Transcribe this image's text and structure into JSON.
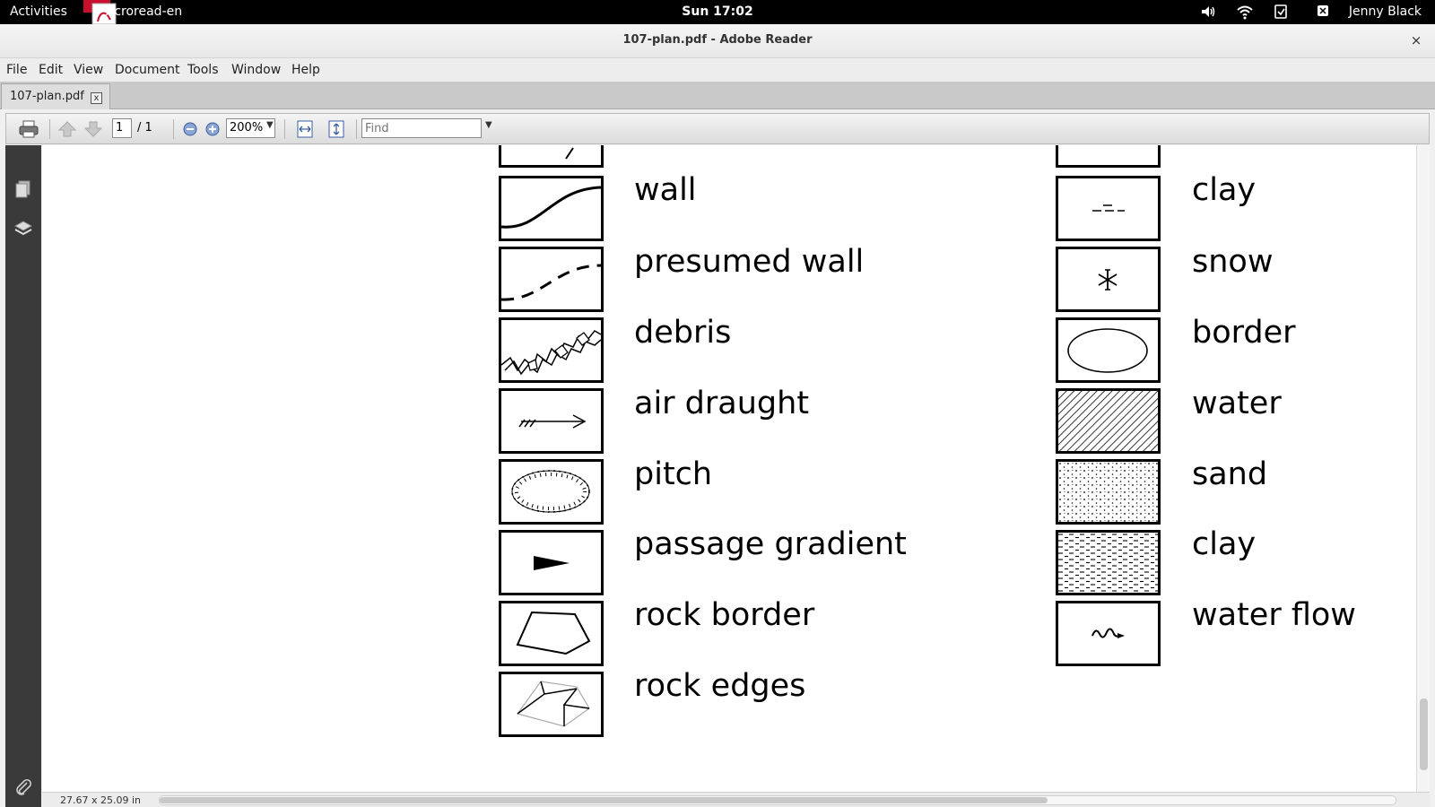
{
  "topbar": {
    "activities": "Activities",
    "app_name": "Acroread-en",
    "clock": "Sun 17:02",
    "user": "Jenny Black"
  },
  "window": {
    "title": "107-plan.pdf - Adobe Reader",
    "close": "×"
  },
  "menu": [
    "File",
    "Edit",
    "View",
    "Document",
    "Tools",
    "Window",
    "Help"
  ],
  "tab": {
    "label": "107-plan.pdf",
    "close": "x"
  },
  "toolbar": {
    "page_current": "1",
    "page_total": "/ 1",
    "zoom": "200%",
    "find_placeholder": "Find"
  },
  "status": {
    "doc_size": "27.67 x 25.09 in"
  },
  "legend": {
    "left": [
      {
        "label": "wall",
        "symbol": "wall-curve-icon"
      },
      {
        "label": "presumed wall",
        "symbol": "dashed-wall-icon"
      },
      {
        "label": "debris",
        "symbol": "debris-icon"
      },
      {
        "label": "air draught",
        "symbol": "air-draught-arrow-icon"
      },
      {
        "label": "pitch",
        "symbol": "pitch-ellipse-icon"
      },
      {
        "label": "passage gradient",
        "symbol": "gradient-triangle-icon"
      },
      {
        "label": "rock border",
        "symbol": "rock-border-polygon-icon"
      },
      {
        "label": "rock edges",
        "symbol": "rock-edges-icon"
      }
    ],
    "right": [
      {
        "label": "clay",
        "symbol": "clay-dash-icon"
      },
      {
        "label": "snow",
        "symbol": "snowflake-icon"
      },
      {
        "label": "border",
        "symbol": "border-ellipse-icon"
      },
      {
        "label": "water",
        "symbol": "water-hatch-icon"
      },
      {
        "label": "sand",
        "symbol": "sand-dots-icon"
      },
      {
        "label": "clay",
        "symbol": "clay-pattern-icon"
      },
      {
        "label": "water flow",
        "symbol": "water-flow-icon"
      }
    ]
  }
}
